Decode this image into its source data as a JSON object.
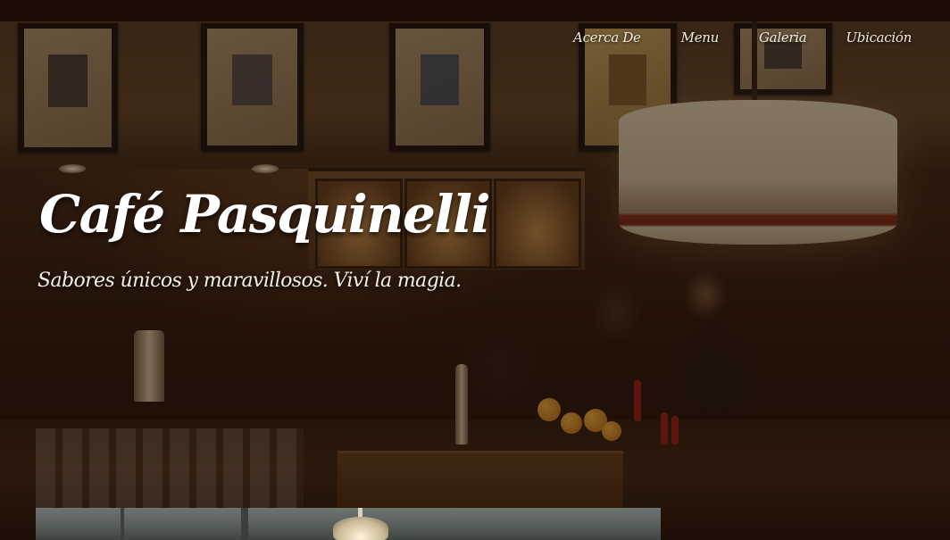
{
  "nav": {
    "items": [
      {
        "label": "Acerca De"
      },
      {
        "label": "Menu"
      },
      {
        "label": "Galeria"
      },
      {
        "label": "Ubicación"
      }
    ]
  },
  "hero": {
    "title": "Café Pasquinelli",
    "subtitle": "Sabores únicos y maravillosos. Viví la magia."
  },
  "colors": {
    "text": "#ffffff",
    "overlay": "#1a0c04"
  }
}
